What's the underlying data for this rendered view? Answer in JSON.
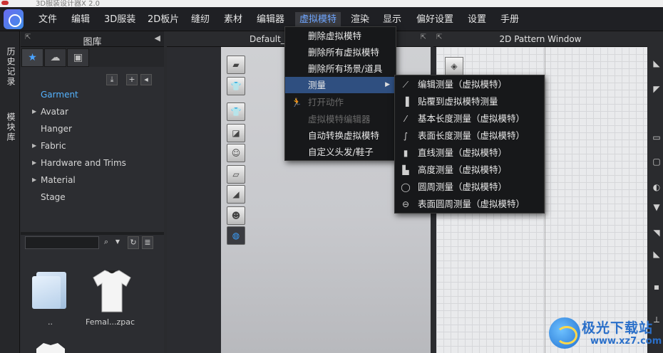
{
  "window": {
    "title": "3D服装设计器X 2.0"
  },
  "menubar": {
    "items": [
      "文件",
      "编辑",
      "3D服装",
      "2D板片",
      "缝纫",
      "素材",
      "编辑器",
      "虚拟模特",
      "渲染",
      "显示",
      "偏好设置",
      "设置",
      "手册"
    ],
    "active": "虚拟模特"
  },
  "side_tabs": [
    "历史记录",
    "模块库"
  ],
  "library": {
    "title": "图库",
    "tabs": [
      "star-icon",
      "cloud-icon",
      "bag-icon"
    ],
    "tree": [
      {
        "label": "Garment",
        "selected": true,
        "expandable": false
      },
      {
        "label": "Avatar",
        "selected": false,
        "expandable": true
      },
      {
        "label": "Hanger",
        "selected": false,
        "expandable": false
      },
      {
        "label": "Fabric",
        "selected": false,
        "expandable": true
      },
      {
        "label": "Hardware and Trims",
        "selected": false,
        "expandable": true
      },
      {
        "label": "Material",
        "selected": false,
        "expandable": true
      },
      {
        "label": "Stage",
        "selected": false,
        "expandable": false
      }
    ],
    "search_placeholder": "",
    "thumbnails": [
      {
        "label": ".."
      },
      {
        "label": "Femal...zpac"
      }
    ]
  },
  "view3d": {
    "title": "Default_"
  },
  "view2d": {
    "title": "2D Pattern Window"
  },
  "avatar_menu": {
    "items": [
      {
        "label": "删除虚拟模特",
        "disabled": false,
        "submenu": false
      },
      {
        "label": "删除所有虚拟模特",
        "disabled": false,
        "submenu": false
      },
      {
        "label": "删除所有场景/道具",
        "disabled": false,
        "submenu": false
      },
      {
        "label": "测量",
        "disabled": false,
        "submenu": true,
        "highlighted": true
      },
      {
        "label": "打开动作",
        "disabled": true,
        "submenu": false
      },
      {
        "label": "虚拟模特编辑器",
        "disabled": true,
        "submenu": false
      },
      {
        "label": "自动转换虚拟模特",
        "disabled": false,
        "submenu": false
      },
      {
        "label": "自定义头发/鞋子",
        "disabled": false,
        "submenu": false
      }
    ]
  },
  "measure_submenu": {
    "items": [
      "编辑测量（虚拟模特）",
      "贴覆到虚拟模特测量",
      "基本长度测量（虚拟模特）",
      "表面长度测量（虚拟模特）",
      "直线测量（虚拟模特）",
      "高度测量（虚拟模特）",
      "圆周测量（虚拟模特）",
      "表面圆周测量（虚拟模特）"
    ]
  },
  "watermark": {
    "name": "极光下载站",
    "url": "www.xz7.com"
  },
  "colors": {
    "accent": "#3aa0ff",
    "menu_highlight": "#2f4f80",
    "brand_blue": "#2a6fc9"
  }
}
